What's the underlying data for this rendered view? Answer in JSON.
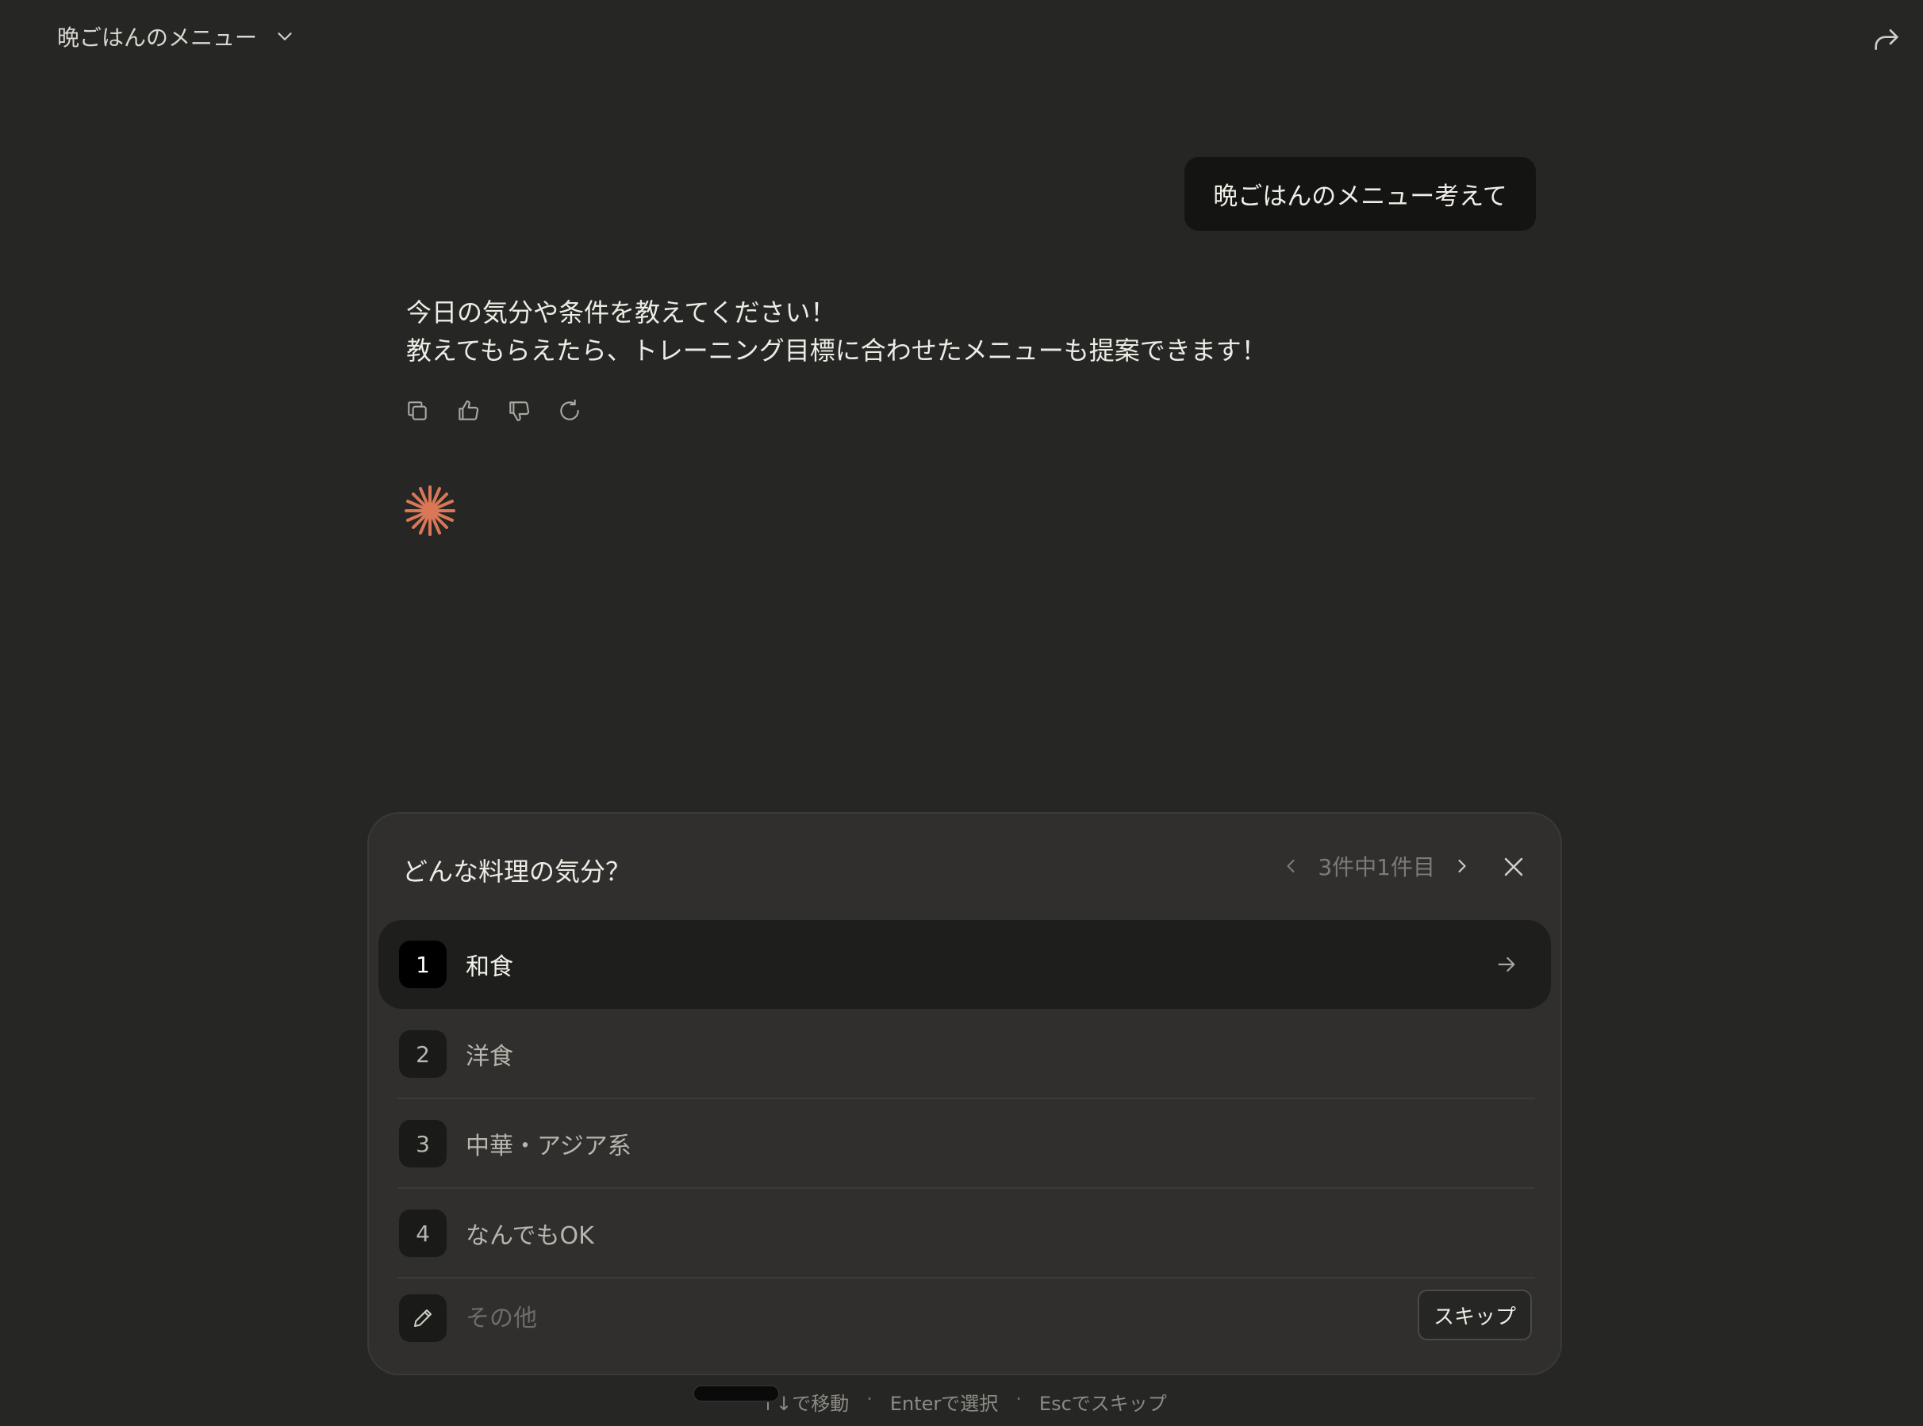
{
  "header": {
    "chat_title": "晩ごはんのメニュー",
    "icons": {
      "dropdown": "chevron-down-icon",
      "share": "share-arrow-icon"
    }
  },
  "conversation": {
    "user_message": "晩ごはんのメニュー考えて",
    "assistant_lines": [
      "今日の気分や条件を教えてください！",
      "教えてもらえたら、トレーニング目標に合わせたメニューも提案できます！"
    ],
    "action_icons": [
      "copy-icon",
      "thumbs-up-icon",
      "thumbs-down-icon",
      "retry-icon"
    ],
    "loading_icon": "sparkle-icon",
    "accent_color": "#d97757"
  },
  "question_panel": {
    "title": "どんな料理の気分？",
    "pager_text": "3件中1件目",
    "options": [
      {
        "num": "1",
        "label": "和食",
        "active": true
      },
      {
        "num": "2",
        "label": "洋食",
        "active": false
      },
      {
        "num": "3",
        "label": "中華・アジア系",
        "active": false
      },
      {
        "num": "4",
        "label": "なんでもOK",
        "active": false
      }
    ],
    "other_placeholder": "その他",
    "skip_label": "スキップ"
  },
  "hints": {
    "move": "↑↓で移動",
    "select": "Enterで選択",
    "skip": "Escでスキップ",
    "separator": "·"
  }
}
